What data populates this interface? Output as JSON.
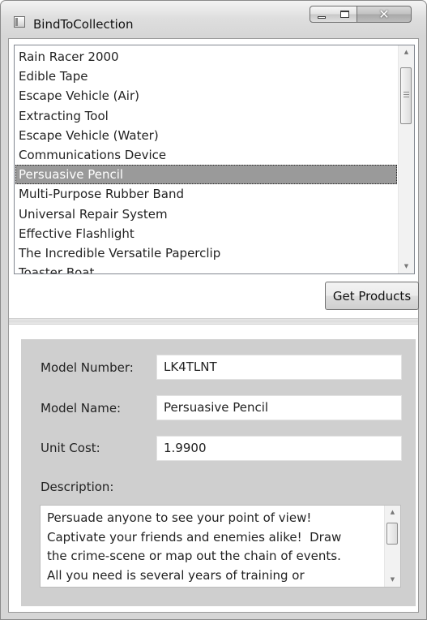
{
  "window": {
    "title": "BindToCollection",
    "close_glyph": "✕"
  },
  "products": {
    "items": [
      "Rain Racer 2000",
      "Edible Tape",
      "Escape Vehicle (Air)",
      "Extracting Tool",
      "Escape Vehicle (Water)",
      "Communications Device",
      "Persuasive Pencil",
      "Multi-Purpose Rubber Band",
      "Universal Repair System",
      "Effective Flashlight",
      "The Incredible Versatile Paperclip",
      "Toaster Boat"
    ],
    "selected_index": 6,
    "scroll_up_glyph": "▲",
    "scroll_down_glyph": "▼"
  },
  "toolbar": {
    "get_products_label": "Get Products"
  },
  "details": {
    "model_number_label": "Model Number:",
    "model_number_value": "LK4TLNT",
    "model_name_label": "Model Name:",
    "model_name_value": "Persuasive Pencil",
    "unit_cost_label": "Unit Cost:",
    "unit_cost_value": "1.9900",
    "description_label": "Description:",
    "description_value": "Persuade anyone to see your point of view!\nCaptivate your friends and enemies alike!  Draw\nthe crime-scene or map out the chain of events.\nAll you need is several years of training or"
  },
  "icons": {
    "app": "window-app-icon",
    "minimize": "minimize-icon",
    "maximize": "maximize-icon",
    "close": "close-icon"
  },
  "colors": {
    "selection": "#9a9a9a",
    "details_panel": "#cfcfcf",
    "window_frame": "#d6d6d6"
  }
}
